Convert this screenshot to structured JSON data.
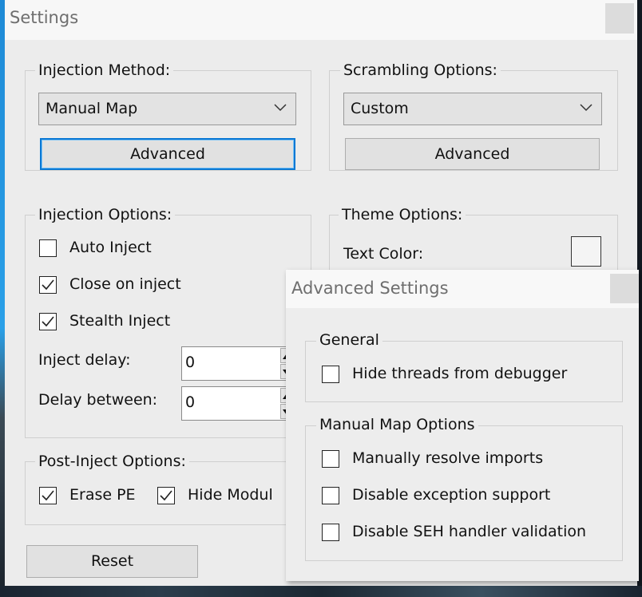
{
  "settings_window": {
    "title": "Settings",
    "injection_method": {
      "label": "Injection Method:",
      "selected": "Manual Map",
      "advanced_button": "Advanced"
    },
    "scrambling_options": {
      "label": "Scrambling Options:",
      "selected": "Custom",
      "advanced_button": "Advanced"
    },
    "injection_options": {
      "label": "Injection Options:",
      "checkboxes": [
        {
          "label": "Auto Inject",
          "checked": false
        },
        {
          "label": "Close on inject",
          "checked": true
        },
        {
          "label": "Stealth Inject",
          "checked": true
        }
      ],
      "inject_delay": {
        "label": "Inject delay:",
        "value": "0"
      },
      "delay_between": {
        "label": "Delay between:",
        "value": "0"
      }
    },
    "theme_options": {
      "label": "Theme Options:",
      "text_color_label": "Text Color:"
    },
    "post_inject_options": {
      "label": "Post-Inject Options:",
      "checkboxes": [
        {
          "label": "Erase PE",
          "checked": true
        },
        {
          "label": "Hide Modul",
          "checked": true
        }
      ]
    },
    "reset_button": "Reset"
  },
  "advanced_window": {
    "title": "Advanced Settings",
    "general": {
      "label": "General",
      "checkboxes": [
        {
          "label": "Hide threads from debugger",
          "checked": false
        }
      ]
    },
    "manual_map_options": {
      "label": "Manual Map Options",
      "checkboxes": [
        {
          "label": "Manually resolve imports",
          "checked": false
        },
        {
          "label": "Disable exception support",
          "checked": false
        },
        {
          "label": "Disable SEH handler validation",
          "checked": false
        }
      ]
    }
  }
}
